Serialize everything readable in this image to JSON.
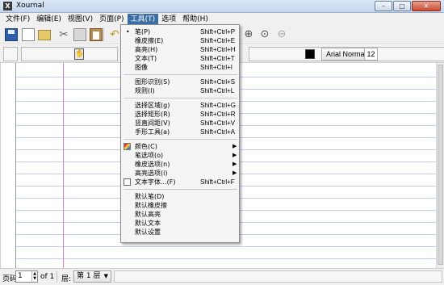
{
  "window": {
    "title": "Xournal",
    "app_icon": "X",
    "minimize": "–",
    "maximize": "□",
    "close": "✕"
  },
  "menubar": [
    "文件(F)",
    "编辑(E)",
    "视图(V)",
    "页面(P)",
    "工具(T)",
    "选项",
    "帮助(H)"
  ],
  "toolbar": {
    "icons": [
      "save-icon",
      "new-document-icon",
      "open-folder-icon",
      "cut-icon",
      "copy-icon",
      "paste-icon",
      "undo-icon",
      "zoom-in-icon",
      "zoom-1-1-icon",
      "zoom-out-icon"
    ],
    "cut_glyph": "✂",
    "undo_glyph": "↶",
    "zoom_in_glyph": "⊕",
    "zoom_11_glyph": "⊙",
    "zoom_out_glyph": "⊖"
  },
  "toolbar2": {
    "hand_glyph": "✋",
    "pen_color": "#000000",
    "font_name": "Arial Normal",
    "font_size": "12"
  },
  "tools_menu": {
    "group1": [
      {
        "label": "笔(P)",
        "accel": "Shift+Ctrl+P",
        "checked": true,
        "bullet": "•"
      },
      {
        "label": "橡皮擦(E)",
        "accel": "Shift+Ctrl+E"
      },
      {
        "label": "高亮(H)",
        "accel": "Shift+Ctrl+H"
      },
      {
        "label": "文本(T)",
        "accel": "Shift+Ctrl+T"
      },
      {
        "label": "图像",
        "accel": "Shift+Ctrl+I"
      }
    ],
    "group2": [
      {
        "label": "图形识别(S)",
        "accel": "Shift+Ctrl+S"
      },
      {
        "label": "规则(I)",
        "accel": "Shift+Ctrl+L"
      }
    ],
    "group3": [
      {
        "label": "选择区域(g)",
        "accel": "Shift+Ctrl+G"
      },
      {
        "label": "选择矩形(R)",
        "accel": "Shift+Ctrl+R"
      },
      {
        "label": "竖直间距(V)",
        "accel": "Shift+Ctrl+V"
      },
      {
        "label": "手形工具(a)",
        "accel": "Shift+Ctrl+A"
      }
    ],
    "group4": [
      {
        "label": "颜色(C)",
        "submenu": "▶"
      },
      {
        "label": "笔选项(o)",
        "submenu": "▶"
      },
      {
        "label": "橡皮选项(n)",
        "submenu": "▶"
      },
      {
        "label": "高亮选项(i)",
        "submenu": "▶"
      },
      {
        "label": "文本字体...(F)",
        "accel": "Shift+Ctrl+F"
      }
    ],
    "group5": [
      {
        "label": "默认笔(D)"
      },
      {
        "label": "默认橡皮擦"
      },
      {
        "label": "默认高亮"
      },
      {
        "label": "默认文本"
      },
      {
        "label": "默认设置"
      }
    ]
  },
  "statusbar": {
    "page_label": "页码",
    "page_value": "1",
    "page_of": "of 1",
    "layer_label": "层:",
    "layer_value": "第 1 层",
    "spin_up": "▲",
    "spin_down": "▼",
    "dropdown_arrow": "▼"
  },
  "colors": {
    "ruled_line": "#bfd0ee",
    "margin_line": "#e67bd0",
    "menu_highlight": "#3a6ea5"
  }
}
